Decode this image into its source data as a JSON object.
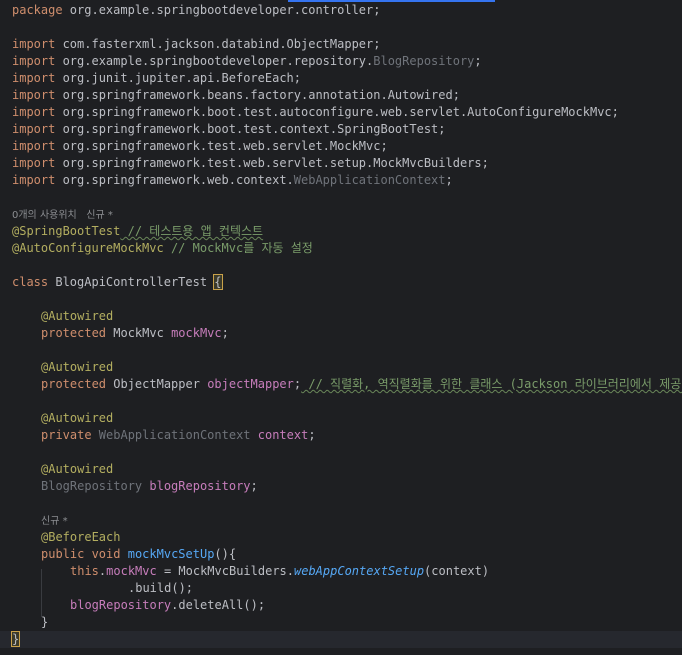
{
  "code": {
    "package_kw": "package",
    "package_name": " org.example.springbootdeveloper.controller;",
    "imports": [
      {
        "kw": "import",
        "path": " com.fasterxml.jackson.databind.ObjectMapper",
        "cls": "",
        "end": ";"
      },
      {
        "kw": "import",
        "path": " org.example.springbootdeveloper.repository.",
        "cls": "BlogRepository",
        "end": ";"
      },
      {
        "kw": "import",
        "path": " org.junit.jupiter.api.BeforeEach",
        "cls": "",
        "end": ";"
      },
      {
        "kw": "import",
        "path": " org.springframework.beans.factory.annotation.Autowired",
        "cls": "",
        "end": ";"
      },
      {
        "kw": "import",
        "path": " org.springframework.boot.test.autoconfigure.web.servlet.AutoConfigureMockMvc",
        "cls": "",
        "end": ";"
      },
      {
        "kw": "import",
        "path": " org.springframework.boot.test.context.SpringBootTest",
        "cls": "",
        "end": ";"
      },
      {
        "kw": "import",
        "path": " org.springframework.test.web.servlet.MockMvc",
        "cls": "",
        "end": ";"
      },
      {
        "kw": "import",
        "path": " org.springframework.test.web.servlet.setup.MockMvcBuilders",
        "cls": "",
        "end": ";"
      },
      {
        "kw": "import",
        "path": " org.springframework.web.context.",
        "cls": "WebApplicationContext",
        "end": ";"
      }
    ],
    "class_hint_usages": "0개의 사용위치",
    "class_hint_new": "신규 *",
    "ann_springboottest": "@SpringBootTest",
    "comment_springboottest": " // 테스트용 앱 컨텍스트",
    "ann_autoconfig": "@AutoConfigureMockMvc",
    "comment_autoconfig": " // MockMvc를 자동 설정",
    "class_kw": "class",
    "class_name": " BlogApiControllerTest ",
    "class_brace": "{",
    "autowired": "@Autowired",
    "f1_mod": "protected",
    "f1_type": " MockMvc ",
    "f1_name": "mockMvc",
    "f2_mod": "protected",
    "f2_type": " ObjectMapper ",
    "f2_name": "objectMapper",
    "f2_comment": " // 직렬화, 역직렬화를 위한 클래스 (Jackson 라이브러리에서 제공)",
    "f3_mod": "private",
    "f3_type": " WebApplicationContext ",
    "f3_name": "context",
    "f4_type": "BlogRepository ",
    "f4_name": "blogRepository",
    "semi": ";",
    "method_hint_new": "신규 *",
    "before_each": "@BeforeEach",
    "m_public": "public",
    "m_void": " void ",
    "m_name": "mockMvcSetUp",
    "m_sig": "(){",
    "m_this": "this",
    "m_dot": ".",
    "m_field": "mockMvc",
    "m_assign": " = MockMvcBuilders.",
    "m_call": "webAppContextSetup",
    "m_args": "(context)",
    "m_build": ".build();",
    "m_repo": "blogRepository",
    "m_delete": ".deleteAll();",
    "m_close": "}",
    "class_close": "}"
  }
}
